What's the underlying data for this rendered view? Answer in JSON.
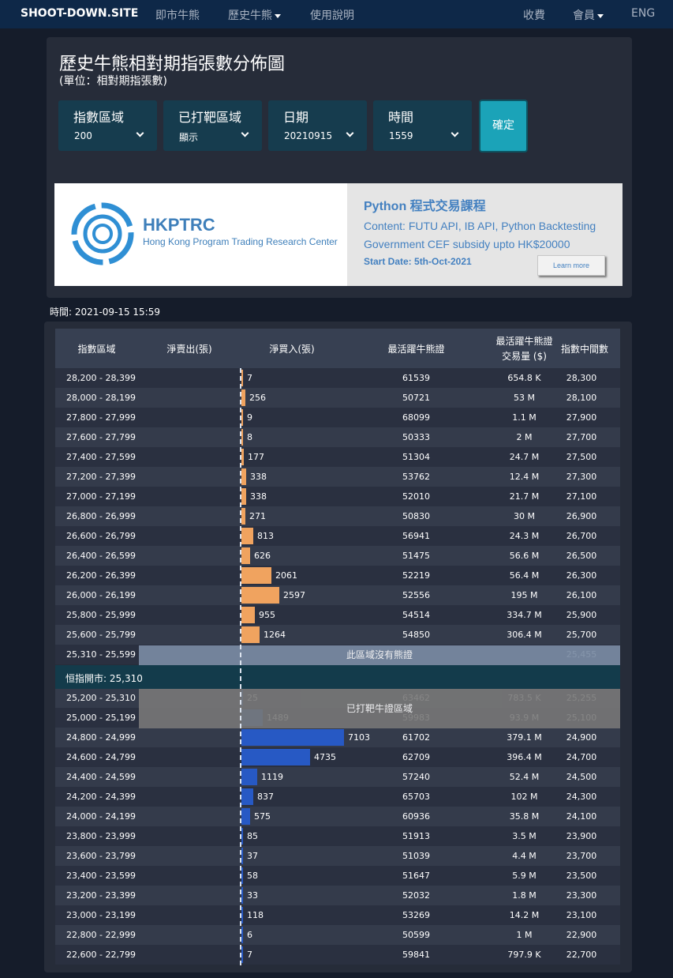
{
  "nav": {
    "brand": "SHOOT-DOWN.SITE",
    "items": [
      "即市牛熊",
      "歷史牛熊",
      "使用說明"
    ],
    "right": [
      "收費",
      "會員",
      "ENG"
    ]
  },
  "page": {
    "title": "歷史牛熊相對期指張數分佈圖",
    "subtitle": "(單位：相對期指張數)"
  },
  "filters": [
    {
      "label": "指數區域",
      "value": "200"
    },
    {
      "label": "已打靶區域",
      "value": "顯示"
    },
    {
      "label": "日期",
      "value": "20210915"
    },
    {
      "label": "時間",
      "value": "1559"
    }
  ],
  "confirm_label": "確定",
  "ad": {
    "name": "HKPTRC",
    "full_name": "Hong Kong Program Trading Research Center",
    "heading": "Python 程式交易課程",
    "line1": "Content: FUTU API, IB API, Python Backtesting",
    "line2": "Government CEF subsidy upto HK$20000",
    "start": "Start Date: 5th-Oct-2021",
    "button": "Learn more"
  },
  "timestamp": "時間: 2021-09-15 15:59",
  "table": {
    "headers": [
      "指數區域",
      "淨賣出(張)",
      "淨買入(張)",
      "最活躍牛熊證",
      "最活躍牛熊證",
      "交易量 ($)",
      "指數中間數"
    ],
    "bear_rows": [
      {
        "zone": "28,200 - 28,399",
        "net": 7,
        "code": "61539",
        "vol": "654.8 K",
        "mid": "28,300"
      },
      {
        "zone": "28,000 - 28,199",
        "net": 256,
        "code": "50721",
        "vol": "53 M",
        "mid": "28,100"
      },
      {
        "zone": "27,800 - 27,999",
        "net": 9,
        "code": "68099",
        "vol": "1.1 M",
        "mid": "27,900"
      },
      {
        "zone": "27,600 - 27,799",
        "net": 8,
        "code": "50333",
        "vol": "2 M",
        "mid": "27,700"
      },
      {
        "zone": "27,400 - 27,599",
        "net": 177,
        "code": "51304",
        "vol": "24.7 M",
        "mid": "27,500"
      },
      {
        "zone": "27,200 - 27,399",
        "net": 338,
        "code": "53762",
        "vol": "12.4 M",
        "mid": "27,300"
      },
      {
        "zone": "27,000 - 27,199",
        "net": 338,
        "code": "52010",
        "vol": "21.7 M",
        "mid": "27,100"
      },
      {
        "zone": "26,800 - 26,999",
        "net": 271,
        "code": "50830",
        "vol": "30 M",
        "mid": "26,900"
      },
      {
        "zone": "26,600 - 26,799",
        "net": 813,
        "code": "56941",
        "vol": "24.3 M",
        "mid": "26,700"
      },
      {
        "zone": "26,400 - 26,599",
        "net": 626,
        "code": "51475",
        "vol": "56.6 M",
        "mid": "26,500"
      },
      {
        "zone": "26,200 - 26,399",
        "net": 2061,
        "code": "52219",
        "vol": "56.4 M",
        "mid": "26,300"
      },
      {
        "zone": "26,000 - 26,199",
        "net": 2597,
        "code": "52556",
        "vol": "195 M",
        "mid": "26,100"
      },
      {
        "zone": "25,800 - 25,999",
        "net": 955,
        "code": "54514",
        "vol": "334.7 M",
        "mid": "25,900"
      },
      {
        "zone": "25,600 - 25,799",
        "net": 1264,
        "code": "54850",
        "vol": "306.4 M",
        "mid": "25,700"
      }
    ],
    "empty_row": {
      "zone": "25,310 - 25,599",
      "mid": "25,455",
      "note": "此區域沒有熊證"
    },
    "spot": "恒指開市: 25,310",
    "hit_rows": [
      {
        "zone": "25,200 - 25,310",
        "net": 25,
        "code": "63462",
        "vol": "783.5 K",
        "mid": "25,255"
      },
      {
        "zone": "25,000 - 25,199",
        "net": 1489,
        "code": "59983",
        "vol": "93.9 M",
        "mid": "25,100"
      }
    ],
    "hit_note": "已打靶牛證區域",
    "bull_rows": [
      {
        "zone": "24,800 - 24,999",
        "net": 7103,
        "code": "61702",
        "vol": "379.1 M",
        "mid": "24,900"
      },
      {
        "zone": "24,600 - 24,799",
        "net": 4735,
        "code": "62709",
        "vol": "396.4 M",
        "mid": "24,700"
      },
      {
        "zone": "24,400 - 24,599",
        "net": 1119,
        "code": "57240",
        "vol": "52.4 M",
        "mid": "24,500"
      },
      {
        "zone": "24,200 - 24,399",
        "net": 837,
        "code": "65703",
        "vol": "102 M",
        "mid": "24,300"
      },
      {
        "zone": "24,000 - 24,199",
        "net": 575,
        "code": "60936",
        "vol": "35.8 M",
        "mid": "24,100"
      },
      {
        "zone": "23,800 - 23,999",
        "net": 85,
        "code": "51913",
        "vol": "3.5 M",
        "mid": "23,900"
      },
      {
        "zone": "23,600 - 23,799",
        "net": 37,
        "code": "51039",
        "vol": "4.4 M",
        "mid": "23,700"
      },
      {
        "zone": "23,400 - 23,599",
        "net": 58,
        "code": "51647",
        "vol": "5.9 M",
        "mid": "23,500"
      },
      {
        "zone": "23,200 - 23,399",
        "net": 33,
        "code": "52032",
        "vol": "1.8 M",
        "mid": "23,300"
      },
      {
        "zone": "23,000 - 23,199",
        "net": 118,
        "code": "53269",
        "vol": "14.2 M",
        "mid": "23,100"
      },
      {
        "zone": "22,800 - 22,999",
        "net": 6,
        "code": "50599",
        "vol": "1 M",
        "mid": "22,900"
      },
      {
        "zone": "22,600 - 22,799",
        "net": 7,
        "code": "59841",
        "vol": "797.9 K",
        "mid": "22,700"
      }
    ]
  },
  "colors": {
    "bear_bar": "#f0a35f",
    "bull_bar": "#2759c4",
    "accent": "#1ba3b8"
  }
}
